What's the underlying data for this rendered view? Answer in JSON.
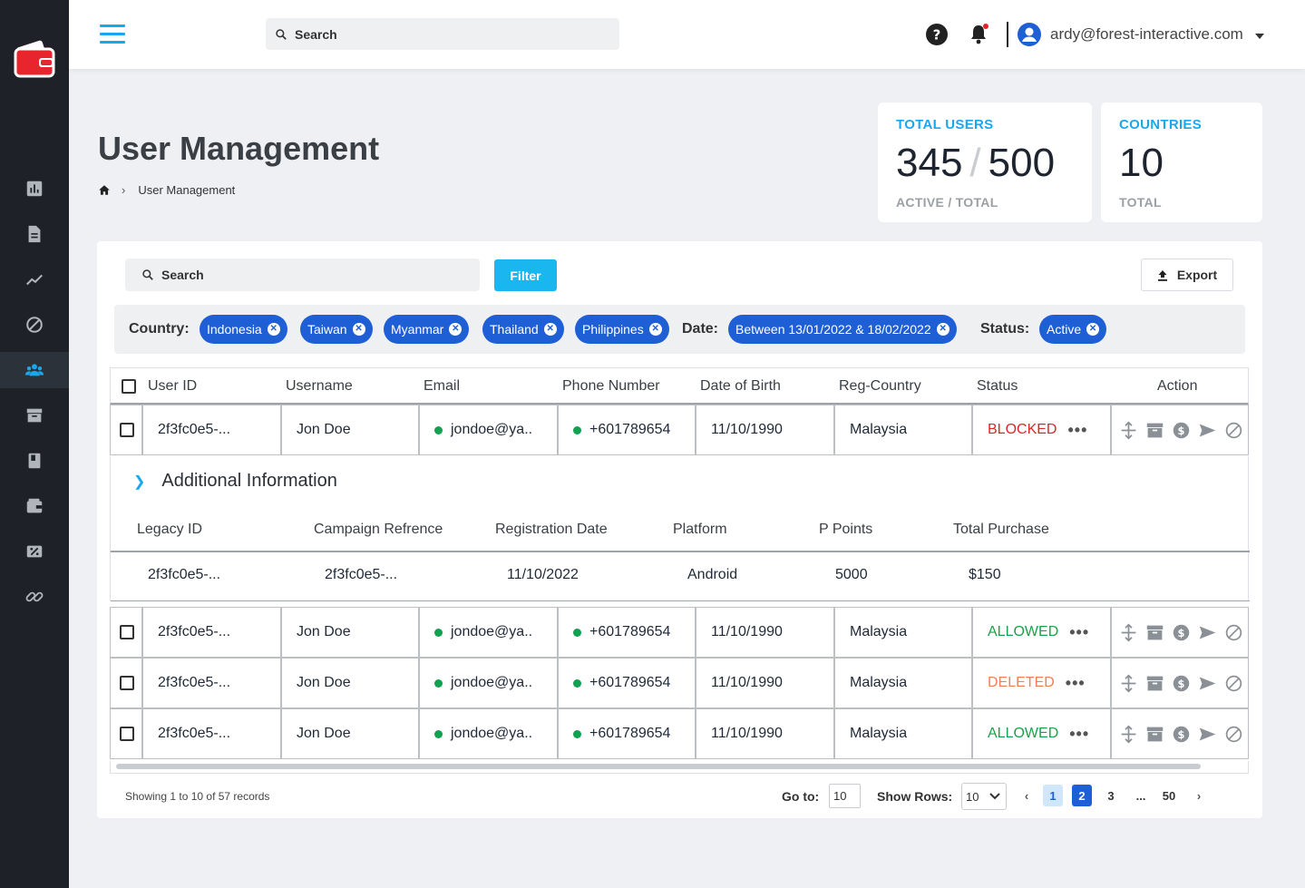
{
  "topbar": {
    "search_placeholder": "Search",
    "user_email": "ardy@forest-interactive.com"
  },
  "page": {
    "title": "User Management",
    "breadcrumb": "User Management"
  },
  "stats": {
    "users": {
      "label": "TOTAL USERS",
      "active": "345",
      "total": "500",
      "sub": "ACTIVE / TOTAL"
    },
    "countries": {
      "label": "COUNTRIES",
      "value": "10",
      "sub": "TOTAL"
    }
  },
  "toolbar": {
    "search_placeholder": "Search",
    "filter_label": "Filter",
    "export_label": "Export"
  },
  "filters": {
    "country_label": "Country:",
    "countries": [
      "Indonesia",
      "Taiwan",
      "Myanmar",
      "Thailand",
      "Philippines"
    ],
    "date_label": "Date:",
    "date_value": "Between 13/01/2022 & 18/02/2022",
    "status_label": "Status:",
    "status_value": "Active"
  },
  "table": {
    "headers": [
      "User ID",
      "Username",
      "Email",
      "Phone Number",
      "Date of Birth",
      "Reg-Country",
      "Status",
      "Action"
    ],
    "rows": [
      {
        "id": "2f3fc0e5-...",
        "username": "Jon Doe",
        "email": "jondoe@ya..",
        "phone": "+601789654",
        "dob": "11/10/1990",
        "country": "Malaysia",
        "status": "BLOCKED",
        "status_color": "#e02424"
      },
      {
        "id": "2f3fc0e5-...",
        "username": "Jon Doe",
        "email": "jondoe@ya..",
        "phone": "+601789654",
        "dob": "11/10/1990",
        "country": "Malaysia",
        "status": "ALLOWED",
        "status_color": "#17a34a"
      },
      {
        "id": "2f3fc0e5-...",
        "username": "Jon Doe",
        "email": "jondoe@ya..",
        "phone": "+601789654",
        "dob": "11/10/1990",
        "country": "Malaysia",
        "status": "DELETED",
        "status_color": "#f07f5a"
      },
      {
        "id": "2f3fc0e5-...",
        "username": "Jon Doe",
        "email": "jondoe@ya..",
        "phone": "+601789654",
        "dob": "11/10/1990",
        "country": "Malaysia",
        "status": "ALLOWED",
        "status_color": "#17a34a"
      }
    ],
    "more_glyph": "•••"
  },
  "additional": {
    "title": "Additional Information",
    "headers": [
      "Legacy ID",
      "Campaign Refrence",
      "Registration Date",
      "Platform",
      "P Points",
      "Total Purchase"
    ],
    "values": [
      "2f3fc0e5-...",
      "2f3fc0e5-...",
      "11/10/2022",
      "Android",
      "5000",
      "$150"
    ]
  },
  "pagination": {
    "showing": "Showing 1 to 10 of 57 records",
    "goto_label": "Go to:",
    "goto_value": "10",
    "rows_label": "Show Rows:",
    "rows_value": "10",
    "pages": [
      "1",
      "2",
      "3",
      "...",
      "50"
    ],
    "current_page": "2"
  },
  "colors": {
    "accent": "#1aa7ec",
    "chip": "#1f5fd6",
    "sidebar": "#1e2228"
  }
}
